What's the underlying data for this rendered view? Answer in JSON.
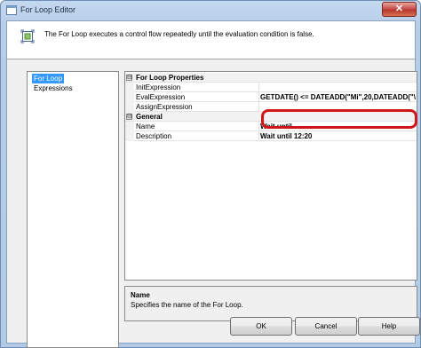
{
  "window": {
    "title": "For Loop Editor",
    "close_glyph": "✕"
  },
  "banner": {
    "text": "The For Loop executes a control flow repeatedly until the evaluation condition is false."
  },
  "nav": {
    "items": [
      {
        "label": "For Loop",
        "selected": true
      },
      {
        "label": "Expressions",
        "selected": false
      }
    ]
  },
  "grid": {
    "categories": [
      {
        "name": "For Loop Properties",
        "toggle": "⊟",
        "rows": [
          {
            "name": "InitExpression",
            "value": ""
          },
          {
            "name": "EvalExpression",
            "value": "GETDATE() <= DATEADD(\"Mi\",20,DATEADD(\"\\"
          },
          {
            "name": "AssignExpression",
            "value": ""
          }
        ]
      },
      {
        "name": "General",
        "toggle": "⊟",
        "rows": [
          {
            "name": "Name",
            "value": "Wait until"
          },
          {
            "name": "Description",
            "value": "Wait until 12:20"
          }
        ]
      }
    ]
  },
  "help": {
    "title": "Name",
    "description": "Specifies the name of the For Loop."
  },
  "buttons": {
    "ok": "OK",
    "cancel": "Cancel",
    "help": "Help"
  },
  "colors": {
    "selection": "#3399ff",
    "highlight": "#d01616"
  }
}
